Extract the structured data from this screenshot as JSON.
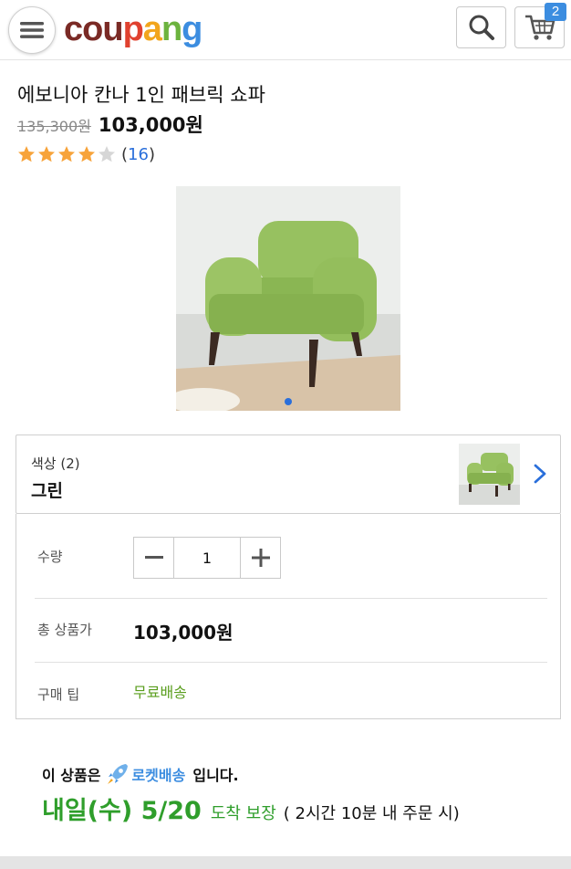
{
  "header": {
    "logo_letters": [
      {
        "ch": "c",
        "color": "#7a2a25"
      },
      {
        "ch": "o",
        "color": "#7a2a25"
      },
      {
        "ch": "u",
        "color": "#7a2a25"
      },
      {
        "ch": "p",
        "color": "#e0412f"
      },
      {
        "ch": "a",
        "color": "#f2a51c"
      },
      {
        "ch": "n",
        "color": "#6cb33e"
      },
      {
        "ch": "g",
        "color": "#3c8de0"
      }
    ],
    "cart_count": "2",
    "icons": [
      "menu-icon",
      "search-icon",
      "cart-icon"
    ]
  },
  "product": {
    "title": "에보니아 칸나 1인 패브릭 쇼파",
    "original_price": "135,300원",
    "sale_price": "103,000원",
    "rating": 4,
    "rating_max": 5,
    "review_count": "16",
    "carousel_dots": 1,
    "carousel_active": 0
  },
  "option": {
    "label": "색상 (2)",
    "value": "그린"
  },
  "info": {
    "quantity_label": "수량",
    "quantity_value": "1",
    "total_label": "총 상품가",
    "total_value": "103,000원",
    "tip_label": "구매 팁",
    "tip_value": "무료배송"
  },
  "delivery": {
    "prefix": "이 상품은",
    "brand": "로켓배송",
    "suffix": "입니다.",
    "arrival_date": "내일(수) 5/20",
    "arrival_guarantee": "도착 보장",
    "arrival_condition": "( 2시간 10분 내 주문 시)"
  },
  "colors": {
    "accent_blue": "#3c8de0",
    "link_blue": "#2a6fdb",
    "star_orange": "#f7a33a",
    "delivery_green": "#2f9e2b",
    "tip_green": "#5a9e1e"
  }
}
